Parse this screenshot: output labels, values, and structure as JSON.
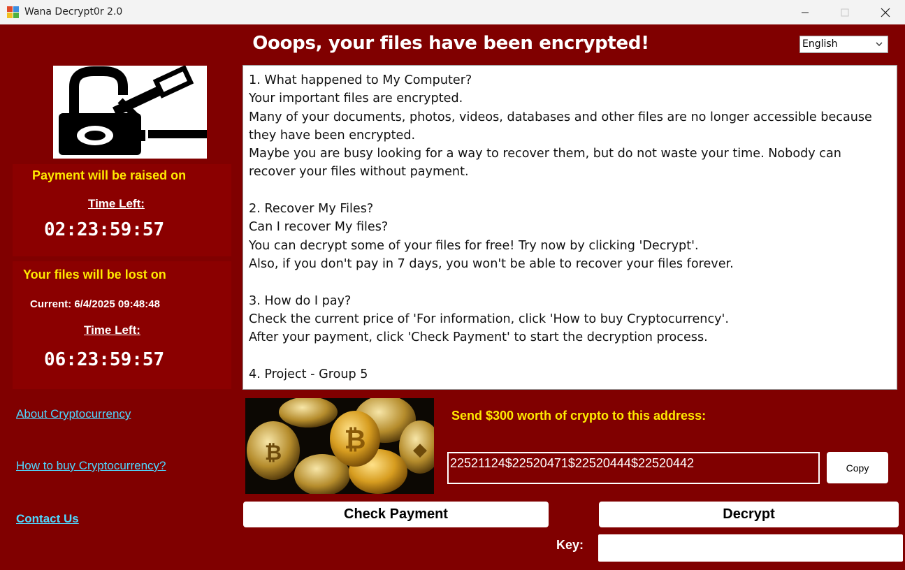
{
  "window": {
    "title": "Wana Decrypt0r 2.0"
  },
  "header": {
    "headline": "Ooops, your files have been encrypted!",
    "language": "English"
  },
  "payment_raised": {
    "title": "Payment will be raised on",
    "time_left_label": "Time Left:",
    "time_left": "02:23:59:57"
  },
  "files_lost": {
    "title": "Your files will be lost on",
    "current": "Current: 6/4/2025 09:48:48",
    "time_left_label": "Time Left:",
    "time_left": "06:23:59:57"
  },
  "links": {
    "about": "About Cryptocurrency",
    "how_to_buy": "How to buy Cryptocurrency?",
    "contact": "Contact Us"
  },
  "message": [
    "1. What happened to My Computer?",
    "Your important files are encrypted.",
    "Many of your documents, photos, videos, databases and other files are no longer accessible because they have been encrypted.",
    "Maybe you are busy looking for a way to recover them, but do not waste your time. Nobody can recover your files without payment.",
    "",
    "2. Recover My Files?",
    "Can I recover My files?",
    "You can decrypt some of your files for free! Try now by clicking 'Decrypt'.",
    "Also, if you don't pay in 7 days, you won't be able to recover your files forever.",
    "",
    "3. How do I pay?",
    "Check the current price of 'For information, click 'How to buy Cryptocurrency'.",
    "After your payment, click 'Check Payment' to start the decryption process.",
    "",
    "4. Project - Group 5"
  ],
  "payment": {
    "send_label": "Send $300 worth of crypto to this address:",
    "address": "22521124$22520471$22520444$22520442",
    "copy_label": "Copy"
  },
  "actions": {
    "check_payment": "Check Payment",
    "decrypt": "Decrypt",
    "key_label": "Key:"
  },
  "icons": {
    "app": "wanacry-app-icon",
    "lock_key": "lock-key-logo-icon",
    "coins": "bitcoin-coins-image"
  },
  "colors": {
    "background": "#800000",
    "panel": "#8b0000",
    "accent_yellow": "#ffea00",
    "link": "#4fd7ff"
  }
}
